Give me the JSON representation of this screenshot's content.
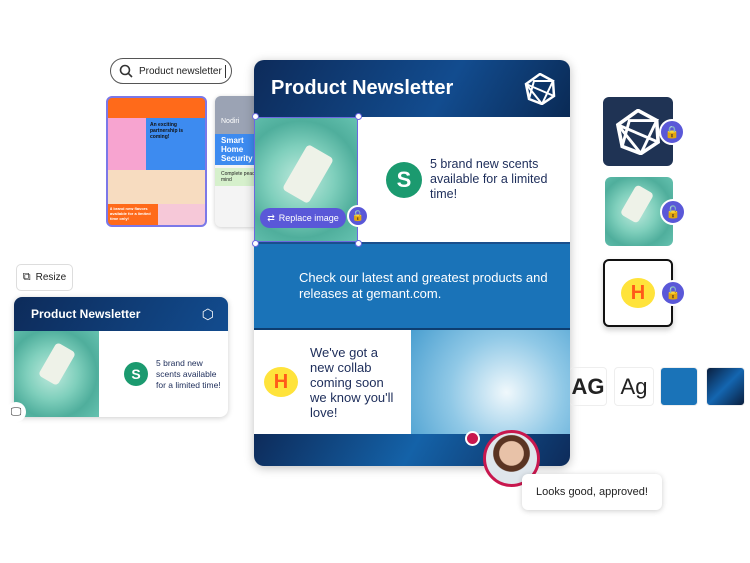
{
  "search": {
    "value": "Product newsletter",
    "icon": "search-icon"
  },
  "templates": [
    {
      "headline": "An exciting partnership is coming!",
      "promo": "8 brand new flavors available for a limited time only!"
    },
    {
      "brand": "Nodiri",
      "headline": "Smart Home Security",
      "subhead": "Complete peace of mind"
    }
  ],
  "newsletter": {
    "title": "Product Newsletter",
    "scents": "5 brand new scents available for a limited time!",
    "band": "Check our latest and greatest products and releases at gemant.com.",
    "collab": "We've got a new collab coming soon we know you'll love!",
    "replace_label": "Replace image",
    "logo_letter": "S",
    "collab_letter": "H"
  },
  "resize": {
    "label": "Resize"
  },
  "small_card": {
    "title": "Product Newsletter",
    "text": "5 brand new scents available for a limited time!"
  },
  "swatches": {
    "font_bold": "AG",
    "font_regular": "Ag",
    "color_blue": "#1a73b8",
    "color_dark": "#0d2b5a"
  },
  "comment": {
    "text": "Looks good, approved!"
  },
  "colors": {
    "accent": "#5a58d8",
    "brand_dark": "#0d2b5a",
    "brand_blue": "#1a73b8",
    "green": "#1b9a6f"
  }
}
